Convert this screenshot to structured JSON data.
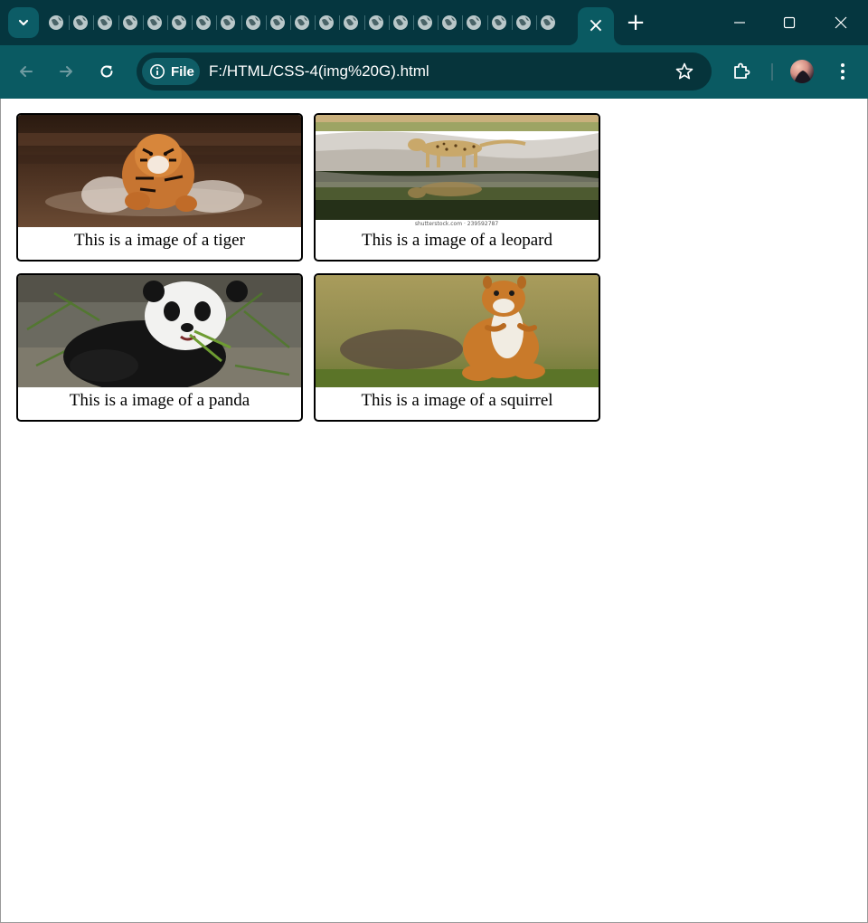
{
  "browser": {
    "tab_count_favicons": 21,
    "active_tab_close_symbol": "×",
    "new_tab_symbol": "+",
    "address": {
      "chip_label": "File",
      "url": "F:/HTML/CSS-4(img%20G).html"
    },
    "colors": {
      "tabstrip": "#05363f",
      "toolbar": "#0a5a62",
      "omnibox": "#06343b"
    },
    "icons": {
      "tab_search": "chevron-down-icon",
      "back": "arrow-left-icon",
      "forward": "arrow-right-icon",
      "reload": "reload-icon",
      "site_info": "info-icon",
      "bookmark": "star-icon",
      "extensions": "puzzle-icon",
      "profile": "avatar",
      "menu": "kebab-menu-icon",
      "minimize": "minimize-icon",
      "maximize": "maximize-icon",
      "close": "close-icon"
    }
  },
  "gallery": [
    {
      "animal": "tiger",
      "caption": "This is a image of a tiger"
    },
    {
      "animal": "leopard",
      "caption": "This is a image of a leopard",
      "watermark": "shutterstock.com · 239592787"
    },
    {
      "animal": "panda",
      "caption": "This is a image of a panda"
    },
    {
      "animal": "squirrel",
      "caption": "This is a image of a squirrel"
    }
  ]
}
